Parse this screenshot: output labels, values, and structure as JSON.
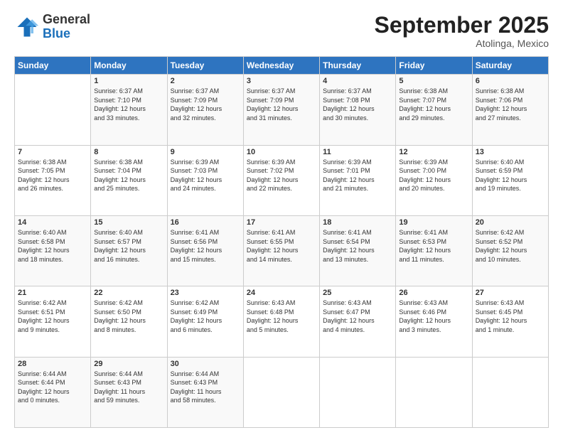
{
  "logo": {
    "general": "General",
    "blue": "Blue"
  },
  "header": {
    "month": "September 2025",
    "location": "Atolinga, Mexico"
  },
  "days_of_week": [
    "Sunday",
    "Monday",
    "Tuesday",
    "Wednesday",
    "Thursday",
    "Friday",
    "Saturday"
  ],
  "weeks": [
    [
      {
        "day": "",
        "info": ""
      },
      {
        "day": "1",
        "info": "Sunrise: 6:37 AM\nSunset: 7:10 PM\nDaylight: 12 hours\nand 33 minutes."
      },
      {
        "day": "2",
        "info": "Sunrise: 6:37 AM\nSunset: 7:09 PM\nDaylight: 12 hours\nand 32 minutes."
      },
      {
        "day": "3",
        "info": "Sunrise: 6:37 AM\nSunset: 7:09 PM\nDaylight: 12 hours\nand 31 minutes."
      },
      {
        "day": "4",
        "info": "Sunrise: 6:37 AM\nSunset: 7:08 PM\nDaylight: 12 hours\nand 30 minutes."
      },
      {
        "day": "5",
        "info": "Sunrise: 6:38 AM\nSunset: 7:07 PM\nDaylight: 12 hours\nand 29 minutes."
      },
      {
        "day": "6",
        "info": "Sunrise: 6:38 AM\nSunset: 7:06 PM\nDaylight: 12 hours\nand 27 minutes."
      }
    ],
    [
      {
        "day": "7",
        "info": "Sunrise: 6:38 AM\nSunset: 7:05 PM\nDaylight: 12 hours\nand 26 minutes."
      },
      {
        "day": "8",
        "info": "Sunrise: 6:38 AM\nSunset: 7:04 PM\nDaylight: 12 hours\nand 25 minutes."
      },
      {
        "day": "9",
        "info": "Sunrise: 6:39 AM\nSunset: 7:03 PM\nDaylight: 12 hours\nand 24 minutes."
      },
      {
        "day": "10",
        "info": "Sunrise: 6:39 AM\nSunset: 7:02 PM\nDaylight: 12 hours\nand 22 minutes."
      },
      {
        "day": "11",
        "info": "Sunrise: 6:39 AM\nSunset: 7:01 PM\nDaylight: 12 hours\nand 21 minutes."
      },
      {
        "day": "12",
        "info": "Sunrise: 6:39 AM\nSunset: 7:00 PM\nDaylight: 12 hours\nand 20 minutes."
      },
      {
        "day": "13",
        "info": "Sunrise: 6:40 AM\nSunset: 6:59 PM\nDaylight: 12 hours\nand 19 minutes."
      }
    ],
    [
      {
        "day": "14",
        "info": "Sunrise: 6:40 AM\nSunset: 6:58 PM\nDaylight: 12 hours\nand 18 minutes."
      },
      {
        "day": "15",
        "info": "Sunrise: 6:40 AM\nSunset: 6:57 PM\nDaylight: 12 hours\nand 16 minutes."
      },
      {
        "day": "16",
        "info": "Sunrise: 6:41 AM\nSunset: 6:56 PM\nDaylight: 12 hours\nand 15 minutes."
      },
      {
        "day": "17",
        "info": "Sunrise: 6:41 AM\nSunset: 6:55 PM\nDaylight: 12 hours\nand 14 minutes."
      },
      {
        "day": "18",
        "info": "Sunrise: 6:41 AM\nSunset: 6:54 PM\nDaylight: 12 hours\nand 13 minutes."
      },
      {
        "day": "19",
        "info": "Sunrise: 6:41 AM\nSunset: 6:53 PM\nDaylight: 12 hours\nand 11 minutes."
      },
      {
        "day": "20",
        "info": "Sunrise: 6:42 AM\nSunset: 6:52 PM\nDaylight: 12 hours\nand 10 minutes."
      }
    ],
    [
      {
        "day": "21",
        "info": "Sunrise: 6:42 AM\nSunset: 6:51 PM\nDaylight: 12 hours\nand 9 minutes."
      },
      {
        "day": "22",
        "info": "Sunrise: 6:42 AM\nSunset: 6:50 PM\nDaylight: 12 hours\nand 8 minutes."
      },
      {
        "day": "23",
        "info": "Sunrise: 6:42 AM\nSunset: 6:49 PM\nDaylight: 12 hours\nand 6 minutes."
      },
      {
        "day": "24",
        "info": "Sunrise: 6:43 AM\nSunset: 6:48 PM\nDaylight: 12 hours\nand 5 minutes."
      },
      {
        "day": "25",
        "info": "Sunrise: 6:43 AM\nSunset: 6:47 PM\nDaylight: 12 hours\nand 4 minutes."
      },
      {
        "day": "26",
        "info": "Sunrise: 6:43 AM\nSunset: 6:46 PM\nDaylight: 12 hours\nand 3 minutes."
      },
      {
        "day": "27",
        "info": "Sunrise: 6:43 AM\nSunset: 6:45 PM\nDaylight: 12 hours\nand 1 minute."
      }
    ],
    [
      {
        "day": "28",
        "info": "Sunrise: 6:44 AM\nSunset: 6:44 PM\nDaylight: 12 hours\nand 0 minutes."
      },
      {
        "day": "29",
        "info": "Sunrise: 6:44 AM\nSunset: 6:43 PM\nDaylight: 11 hours\nand 59 minutes."
      },
      {
        "day": "30",
        "info": "Sunrise: 6:44 AM\nSunset: 6:43 PM\nDaylight: 11 hours\nand 58 minutes."
      },
      {
        "day": "",
        "info": ""
      },
      {
        "day": "",
        "info": ""
      },
      {
        "day": "",
        "info": ""
      },
      {
        "day": "",
        "info": ""
      }
    ]
  ]
}
